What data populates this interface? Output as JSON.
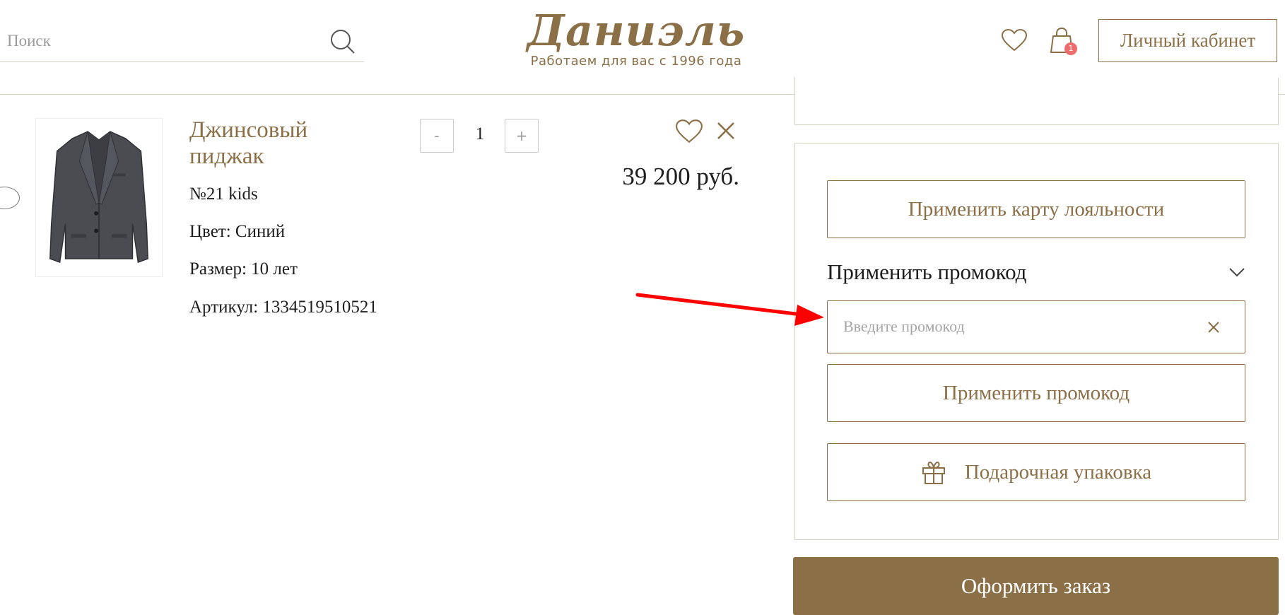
{
  "header": {
    "search": {
      "placeholder": "Поиск",
      "value": ""
    },
    "logo": {
      "name": "Даниэль",
      "tagline": "Работаем для вас с 1996 года"
    },
    "cart_count": "1",
    "account_label": "Личный кабинет"
  },
  "cart_item": {
    "title": "Джинсовый пиджак",
    "brand": "№21 kids",
    "color": "Цвет: Синий",
    "size": "Размер: 10 лет",
    "sku": "Артикул: 1334519510521",
    "quantity": "1",
    "decrement_label": "-",
    "increment_label": "+",
    "price": "39 200 руб."
  },
  "panel": {
    "loyalty_label": "Применить карту лояльности",
    "promo_toggle_label": "Применить промокод",
    "promo_field": {
      "placeholder": "Введите промокод",
      "value": ""
    },
    "apply_promo_label": "Применить промокод",
    "gift_wrap_label": "Подарочная упаковка"
  },
  "checkout_label": "Оформить заказ",
  "colors": {
    "brand": "#8b6f47",
    "badge": "#f06c6c",
    "annotation_arrow": "#ff0000"
  },
  "icons": [
    "search-icon",
    "heart-icon",
    "cart-icon",
    "close-icon",
    "chevron-down-icon",
    "gift-icon",
    "arrow-icon"
  ]
}
